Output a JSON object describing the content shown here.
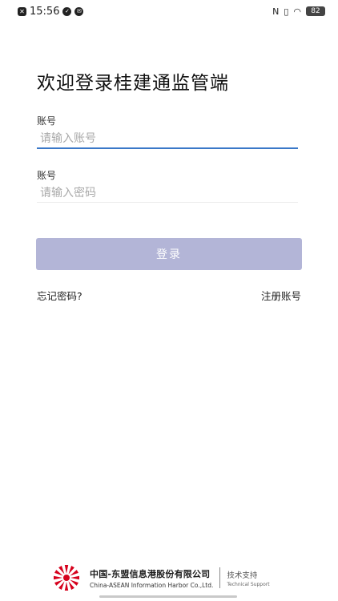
{
  "status_bar": {
    "time": "15:56",
    "battery": "82",
    "left_icons": [
      "app-notification-icon",
      "check-circle-icon",
      "message-circle-icon"
    ],
    "right_icons": [
      "nfc-icon",
      "vibrate-icon",
      "wifi-icon",
      "battery-icon"
    ]
  },
  "page": {
    "title": "欢迎登录桂建通监管端"
  },
  "account_field": {
    "label": "账号",
    "placeholder": "请输入账号",
    "value": "",
    "underline_color": "#3a78c8"
  },
  "password_field": {
    "label": "账号",
    "placeholder": "请输入密码",
    "value": "",
    "underline_color": "#ececec"
  },
  "login_button": {
    "label": "登录",
    "color": "#b3b5d7"
  },
  "links": {
    "forgot_password": "忘记密码?",
    "register": "注册账号"
  },
  "footer": {
    "company_cn": "中国-东盟信息港股份有限公司",
    "company_en": "China-ASEAN Information Harbor Co.,Ltd.",
    "support_cn": "技术支持",
    "support_en": "Technical Support",
    "logo_color": "#d6001c"
  }
}
